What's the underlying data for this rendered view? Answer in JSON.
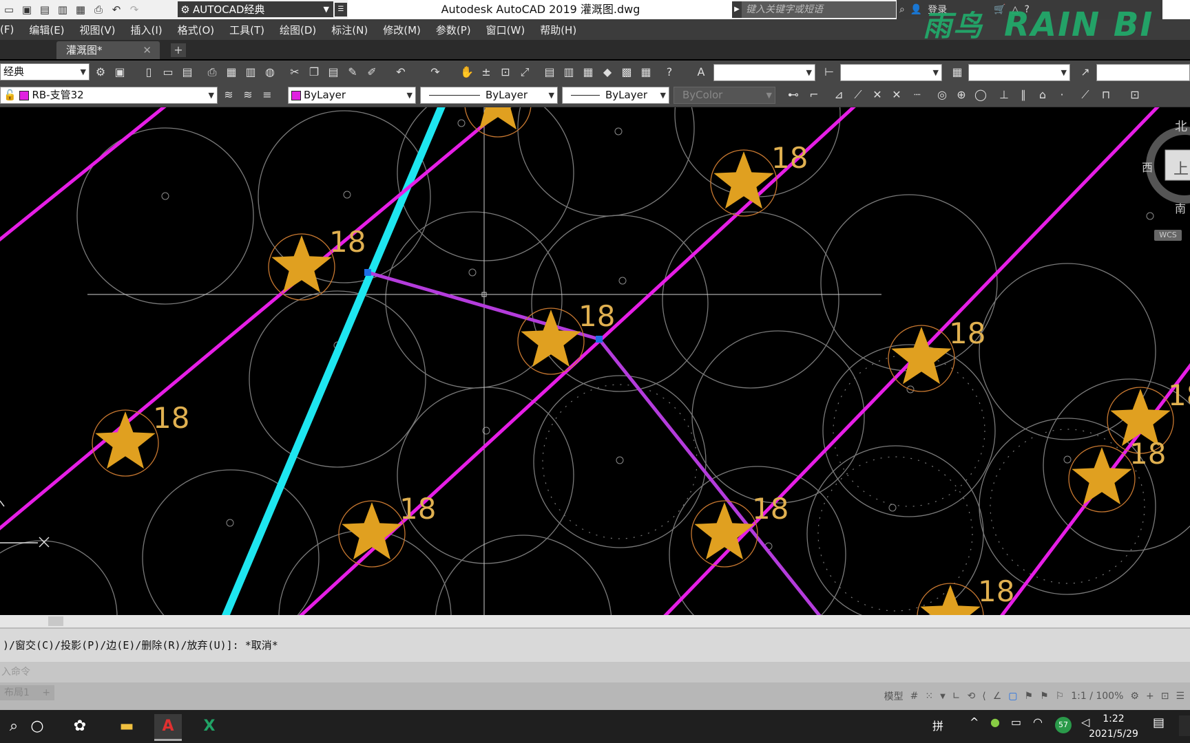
{
  "titlebar": {
    "workspace": "AUTOCAD经典",
    "title": "Autodesk AutoCAD 2019    灌溉图.dwg",
    "search_placeholder": "键入关键字或短语",
    "login": "登录"
  },
  "logo": {
    "cn": "雨鸟",
    "en": "RAIN BI"
  },
  "menu": [
    "(F)",
    "编辑(E)",
    "视图(V)",
    "插入(I)",
    "格式(O)",
    "工具(T)",
    "绘图(D)",
    "标注(N)",
    "修改(M)",
    "参数(P)",
    "窗口(W)",
    "帮助(H)"
  ],
  "tabs": {
    "doc": "灌溉图*",
    "close": "✕",
    "add": "+"
  },
  "toolbar1": {
    "workspace_combo": "经典"
  },
  "toolbar2": {
    "layer": "RB-支管32",
    "color": "ByLayer",
    "linetype": "ByLayer",
    "lineweight": "ByLayer",
    "plotstyle": "ByColor"
  },
  "drawing": {
    "head_label": "18",
    "viewcube": {
      "north": "北",
      "west": "西",
      "south": "南",
      "top": "上",
      "wcs": "WCS"
    }
  },
  "command": {
    "history": ")/窗交(C)/投影(P)/边(E)/删除(R)/放弃(U)]:  *取消*",
    "prompt": "入命令"
  },
  "status": {
    "layout": "布局1",
    "model": "模型",
    "scale": "1:1 / 100%"
  },
  "taskbar": {
    "time": "1:22",
    "date": "2021/5/29",
    "ime": "拼",
    "battery": "57"
  },
  "colors": {
    "pipe_main": "#e61ee6",
    "pipe_branch": "#b43cdc",
    "cyan_pipe": "#1ee6f0",
    "sprinkler": "#e0a020",
    "label": "#e0b050"
  }
}
